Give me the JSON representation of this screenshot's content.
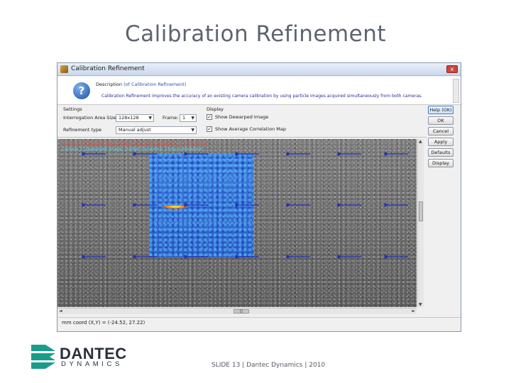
{
  "slide": {
    "title": "Calibration Refinement",
    "footer": "SLIDE 13 | Dantec Dynamics | 2010"
  },
  "logo": {
    "top": "DANTEC",
    "bottom": "DYNAMICS",
    "color": "#1a9b8c"
  },
  "window": {
    "title": "Calibration Refinement",
    "close_glyph": "x",
    "description": {
      "label": "Description",
      "link": "(of Calibration Refinement)",
      "text": "Calibration Refinement improves the accuracy of an existing camera calibration by using particle images acquired simultaneously from both cameras."
    },
    "settings": {
      "group": "Settings",
      "ia_label": "Interrogation Area Size",
      "ia_value": "128x128",
      "frame_label": "Frame:",
      "frame_value": "1",
      "refinement_label": "Refinement type",
      "refinement_value": "Manual adjust"
    },
    "display": {
      "group": "Display",
      "show_dewarped": "Show Dewarped Image",
      "show_average": "Show Average Correlation Map",
      "dewarped_checked": true,
      "average_checked": true
    },
    "buttons": [
      "Help (OK)",
      "OK",
      "Cancel",
      "Apply",
      "Defaults",
      "Display"
    ],
    "overlay": {
      "line1": "Camera 1 (Disparity Map, Dantec Dynamics; Disparity = 0.19 pixels)",
      "line2": "Camera 2 (Dewarped Image, Dantec Dynamics; Cross-correlation)"
    },
    "hscroll_thumb": "|||",
    "status": "mm coord (X,Y) = (-24.52, 27.22)"
  },
  "colors": {
    "vector": "#1f2fb8",
    "hotspot": "#ff6a00"
  }
}
